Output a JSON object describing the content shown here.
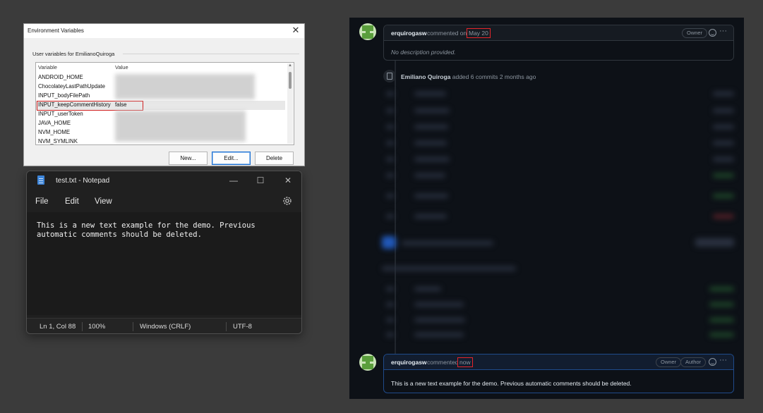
{
  "env_dialog": {
    "title": "Environment Variables",
    "close_glyph": "✕",
    "group_label": "User variables for EmilianoQuiroga",
    "columns": [
      "Variable",
      "Value"
    ],
    "rows": [
      {
        "name": "ANDROID_HOME",
        "value": ""
      },
      {
        "name": "ChocolateyLastPathUpdate",
        "value": ""
      },
      {
        "name": "INPUT_bodyFilePath",
        "value": ""
      },
      {
        "name": "INPUT_keepCommentHistory",
        "value": "false"
      },
      {
        "name": "INPUT_userToken",
        "value": ""
      },
      {
        "name": "JAVA_HOME",
        "value": ""
      },
      {
        "name": "NVM_HOME",
        "value": ""
      },
      {
        "name": "NVM_SYMLINK",
        "value": ""
      }
    ],
    "buttons": {
      "new": "New...",
      "edit": "Edit...",
      "delete": "Delete"
    },
    "highlight_color": "#d12020"
  },
  "notepad": {
    "title": "test.txt - Notepad",
    "window_buttons": {
      "minimize": "—",
      "maximize": "☐",
      "close": "✕"
    },
    "menu": {
      "file": "File",
      "edit": "Edit",
      "view": "View"
    },
    "content": "This is a new text example for the demo. Previous\nautomatic comments should be deleted.",
    "status": {
      "position": "Ln 1, Col 88",
      "zoom": "100%",
      "line_ending": "Windows (CRLF)",
      "encoding": "UTF-8"
    }
  },
  "github": {
    "first_comment": {
      "author": "erquirogasw",
      "action": "commented on",
      "time": "May 20",
      "badge_owner": "Owner",
      "body": "No description provided."
    },
    "commit_event": {
      "actor": "Emiliano Quiroga",
      "text": "added 6 commits 2 months ago"
    },
    "second_comment": {
      "author": "erquirogasw",
      "action": "commented",
      "time": "now",
      "badge_owner": "Owner",
      "badge_author": "Author",
      "body": "This is a new text example for the demo. Previous automatic comments should be deleted."
    },
    "more_glyph": "···",
    "highlight_color": "#e5252a"
  }
}
